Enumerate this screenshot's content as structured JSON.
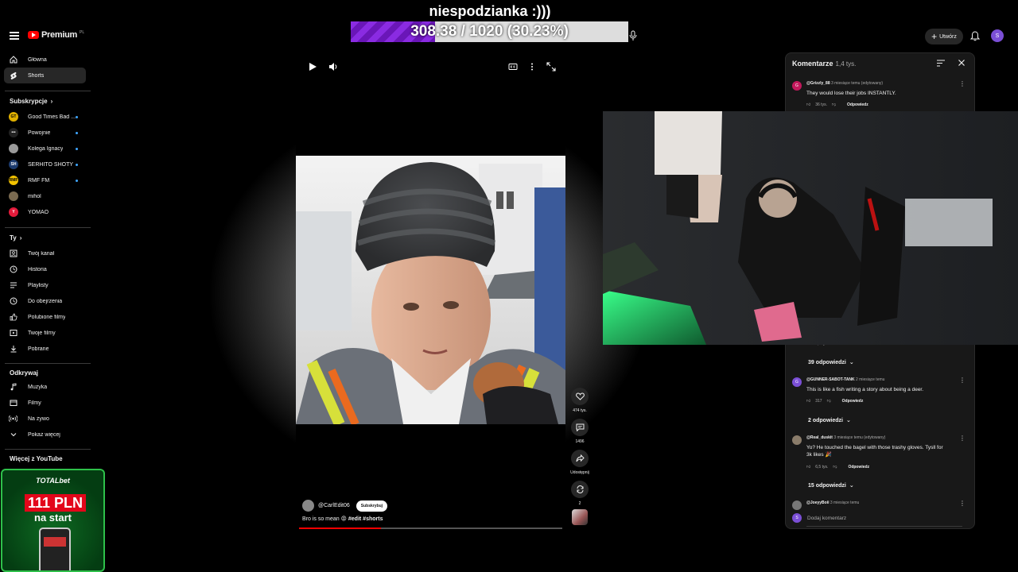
{
  "overlay": {
    "title": "niespodzianka :)))",
    "goal_text": "308.38 / 1020 (30.23%)",
    "goal_progress": 0.3023
  },
  "header": {
    "logo_text": "Premium",
    "logo_region": "PL",
    "create_label": "Utwórz",
    "avatar_letter": "S"
  },
  "sidebar": {
    "main": [
      {
        "label": "Główna",
        "icon": "home-icon"
      },
      {
        "label": "Shorts",
        "icon": "shorts-icon",
        "active": true
      }
    ],
    "subscriptions_title": "Subskrypcje",
    "subscriptions": [
      {
        "label": "Good Times Bad ...",
        "color": "#e0b000",
        "initials": "GT",
        "dot": true
      },
      {
        "label": "Powojnie",
        "color": "#222222",
        "initials": "•••",
        "dot": true
      },
      {
        "label": "Kolega Ignacy",
        "color": "#9a9a9a",
        "initials": "",
        "dot": true
      },
      {
        "label": "SERHITO SHOTY",
        "color": "#1c3b6e",
        "initials": "SH",
        "dot": true
      },
      {
        "label": "RMF FM",
        "color": "#f2c200",
        "initials": "RMF",
        "dot": true
      },
      {
        "label": "mihol",
        "color": "#7a6a50",
        "initials": "",
        "dot": false
      },
      {
        "label": "YOMAO",
        "color": "#e31b3b",
        "initials": "Y",
        "dot": false
      }
    ],
    "you_title": "Ty",
    "you": [
      {
        "label": "Twój kanał",
        "icon": "channel-icon"
      },
      {
        "label": "Historia",
        "icon": "history-icon"
      },
      {
        "label": "Playlisty",
        "icon": "playlist-icon"
      },
      {
        "label": "Do obejrzenia",
        "icon": "watch-later-icon"
      },
      {
        "label": "Polubione filmy",
        "icon": "liked-icon"
      },
      {
        "label": "Twoje filmy",
        "icon": "your-videos-icon"
      },
      {
        "label": "Pobrane",
        "icon": "download-icon"
      }
    ],
    "explore_title": "Odkrywaj",
    "explore": [
      {
        "label": "Muzyka",
        "icon": "music-icon"
      },
      {
        "label": "Filmy",
        "icon": "movies-icon"
      },
      {
        "label": "Na żywo",
        "icon": "live-icon"
      },
      {
        "label": "Pokaż więcej",
        "icon": "chevron-down-icon"
      }
    ],
    "more_title": "Więcej z YouTube"
  },
  "ad": {
    "brand": "TOTALbet",
    "amount": "111 PLN",
    "sub": "na start"
  },
  "video": {
    "channel": "@CarlEdit06",
    "subscribe_label": "Subskrybuj",
    "caption_text": "Bro is so mean 😡",
    "caption_tags": "#edit #shorts",
    "progress": 0.31
  },
  "actions": {
    "likes": "474 tys.",
    "comments": "1496",
    "share": "Udostępnij",
    "remix": "2"
  },
  "comments": {
    "title": "Komentarze",
    "count": "1,4 tys.",
    "items": [
      {
        "author": "@Grizzly_88",
        "time": "3 miesiące temu (edytowany)",
        "text": "They would lose their jobs INSTANTLY.",
        "likes": "36 tys.",
        "avatar_color": "#c2185b",
        "avatar_letter": "G",
        "reply": "Odpowiedz"
      },
      {
        "author": "@GUNNER-SABOT-TANK",
        "time": "2 miesiące temu",
        "text": "This is like a fish writing a story about being a deer.",
        "likes": "317",
        "avatar_color": "#7b4fd6",
        "avatar_letter": "G",
        "reply": "Odpowiedz"
      },
      {
        "author": "@Real_duskit",
        "time": "3 miesiące temu (edytowany)",
        "text": "Yo? He touched the bagel with those trashy gloves. Tysll for 3k likes 🎉",
        "likes": "6,5 tys.",
        "avatar_color": "#8a7c6a",
        "avatar_letter": "",
        "reply": "Odpowiedz"
      },
      {
        "author": "@JoeyyBoii",
        "time": "3 miesiące temu",
        "text": "",
        "likes": "",
        "avatar_color": "#777777",
        "avatar_letter": "",
        "reply": ""
      }
    ],
    "replies": [
      "39 odpowiedzi",
      "2 odpowiedzi",
      "15 odpowiedzi"
    ],
    "hidden_likes": "4,3 tys.",
    "add_placeholder": "Dodaj komentarz",
    "add_avatar_letter": "S"
  }
}
